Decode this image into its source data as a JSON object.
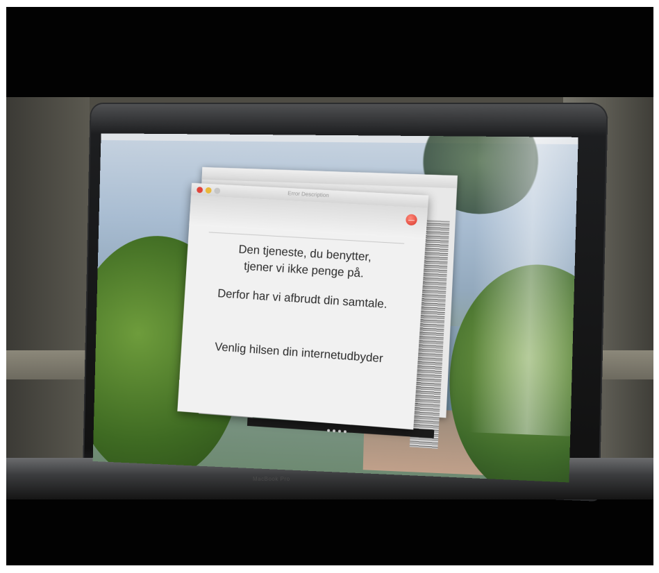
{
  "device": {
    "brand": "MacBook Pro"
  },
  "dialog": {
    "window_title": "Error Description",
    "message_line1": "Den tjeneste, du benytter,",
    "message_line2": "tjener vi ikke penge på.",
    "message_line3": "Derfor har vi afbrudt din samtale.",
    "signature": "Venlig hilsen din internetudbyder",
    "stop_symbol": "—"
  },
  "colors": {
    "close": "#e0443a",
    "minimize": "#e9b83b",
    "stop": "#d8342a"
  }
}
